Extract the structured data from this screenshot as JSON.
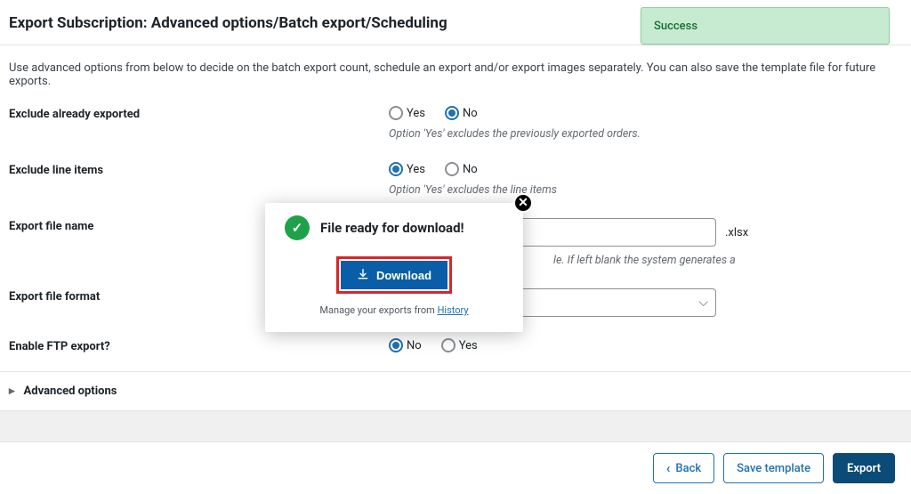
{
  "toast": {
    "text": "Success"
  },
  "header": {
    "title": "Export Subscription: Advanced options/Batch export/Scheduling"
  },
  "intro": "Use advanced options from below to decide on the batch export count, schedule an export and/or export images separately. You can also save the template file for future exports.",
  "fields": {
    "exclude_exported": {
      "label": "Exclude already exported",
      "yes": "Yes",
      "no": "No",
      "help": "Option 'Yes' excludes the previously exported orders."
    },
    "exclude_line_items": {
      "label": "Exclude line items",
      "yes": "Yes",
      "no": "No",
      "help": "Option 'Yes' excludes the line items"
    },
    "filename": {
      "label": "Export file name",
      "value": "",
      "ext": ".xlsx",
      "help_tail": "le. If left blank the system generates a"
    },
    "format": {
      "label": "Export file format",
      "value": ""
    },
    "ftp": {
      "label": "Enable FTP export?",
      "no": "No",
      "yes": "Yes"
    }
  },
  "advanced_label": "Advanced options",
  "footer": {
    "back": "Back",
    "save": "Save template",
    "export": "Export"
  },
  "modal": {
    "title": "File ready for download!",
    "download": "Download",
    "manage_prefix": "Manage your exports from ",
    "history": "History"
  }
}
